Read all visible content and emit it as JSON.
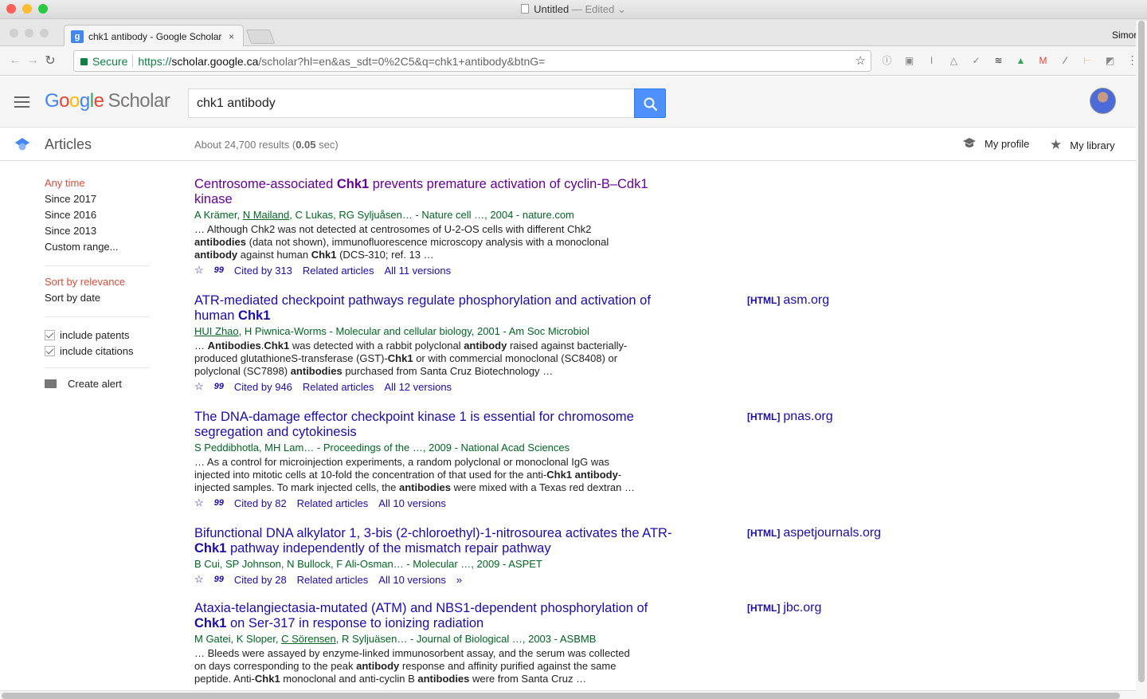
{
  "window": {
    "title": "Untitled",
    "title_suffix": "— Edited ⌄"
  },
  "browser": {
    "tab_title": "chk1 antibody - Google Scholar",
    "tab_close": "×",
    "profile_name": "Simon",
    "secure_label": "Secure",
    "url_scheme": "https://",
    "url_host": "scholar.google.ca",
    "url_path": "/scholar?hl=en&as_sdt=0%2C5&q=chk1+antibody&btnG=",
    "extensions": [
      "info-icon",
      "evernote-icon",
      "instapaper-icon",
      "drive-gray-icon",
      "checkmark-icon",
      "buffer-icon",
      "google-drive-icon",
      "gmail-icon",
      "eyedropper-icon",
      "signpost-icon",
      "extension-icon"
    ]
  },
  "header": {
    "logo_google": [
      "G",
      "o",
      "o",
      "g",
      "l",
      "e"
    ],
    "logo_colors": [
      "#4285f4",
      "#ea4335",
      "#fbbc05",
      "#4285f4",
      "#34a853",
      "#ea4335"
    ],
    "logo_scholar": "Scholar",
    "search_value": "chk1 antibody"
  },
  "subbar": {
    "section": "Articles",
    "results_prefix": "About 24,700 results (",
    "results_time": "0.05",
    "results_suffix": " sec)",
    "my_profile": "My profile",
    "my_library": "My library"
  },
  "sidebar": {
    "time_filters": [
      {
        "label": "Any time",
        "active": true
      },
      {
        "label": "Since 2017",
        "active": false
      },
      {
        "label": "Since 2016",
        "active": false
      },
      {
        "label": "Since 2013",
        "active": false
      },
      {
        "label": "Custom range...",
        "active": false
      }
    ],
    "sort": [
      {
        "label": "Sort by relevance",
        "active": true
      },
      {
        "label": "Sort by date",
        "active": false
      }
    ],
    "include_patents": "include patents",
    "include_citations": "include citations",
    "create_alert": "Create alert"
  },
  "results": [
    {
      "title_html": "Centrosome-associated <b>Chk1</b> prevents premature activation of cyclin-B–Cdk1 kinase",
      "visited": true,
      "meta_html": "A Krämer, <u>N Mailand</u>, C Lukas, RG Syljuåsen… - Nature cell …, 2004 - nature.com",
      "snippet_html": "… Although Chk2 was not detected at centrosomes of U-2-OS cells with different Chk2 <b>antibodies</b> (data not shown), immunofluorescence microscopy analysis with a monoclonal <b>antibody</b> against human <b>Chk1</b> (DCS-310; ref. 13 …",
      "cited_by": "Cited by 313",
      "related": "Related articles",
      "versions": "All 11 versions",
      "side_tag": "",
      "side_domain": ""
    },
    {
      "title_html": "ATR-mediated checkpoint pathways regulate phosphorylation and activation of human <b>Chk1</b>",
      "visited": false,
      "meta_html": "<u>HUI Zhao</u>, H Piwnica-Worms - Molecular and cellular biology, 2001 - Am Soc Microbiol",
      "snippet_html": "… <b>Antibodies</b>.<b>Chk1</b> was detected with a rabbit polyclonal <b>antibody</b> raised against bacterially-produced glutathioneS-transferase (GST)-<b>Chk1</b> or with commercial monoclonal (SC8408) or polyclonal (SC7898) <b>antibodies</b> purchased from Santa Cruz Biotechnology …",
      "cited_by": "Cited by 946",
      "related": "Related articles",
      "versions": "All 12 versions",
      "side_tag": "[HTML]",
      "side_domain": "asm.org"
    },
    {
      "title_html": "The DNA-damage effector checkpoint kinase 1 is essential for chromosome segregation and cytokinesis",
      "visited": false,
      "meta_html": "S Peddibhotla, MH Lam… - Proceedings of the …, 2009 - National Acad Sciences",
      "snippet_html": "… As a control for microinjection experiments, a random polyclonal or monoclonal IgG was injected into mitotic cells at 10-fold the concentration of that used for the anti-<b>Chk1 antibody</b>-injected samples. To mark injected cells, the <b>antibodies</b> were mixed with a Texas red dextran …",
      "cited_by": "Cited by 82",
      "related": "Related articles",
      "versions": "All 10 versions",
      "side_tag": "[HTML]",
      "side_domain": "pnas.org"
    },
    {
      "title_html": "Bifunctional DNA alkylator 1, 3-bis (2-chloroethyl)-1-nitrosourea activates the ATR-<b>Chk1</b> pathway independently of the mismatch repair pathway",
      "visited": false,
      "meta_html": "B Cui, SP Johnson, N Bullock, F Ali-Osman… - Molecular …, 2009 - ASPET",
      "snippet_html": "",
      "cited_by": "Cited by 28",
      "related": "Related articles",
      "versions": "All 10 versions",
      "more": "»",
      "side_tag": "[HTML]",
      "side_domain": "aspetjournals.org"
    },
    {
      "title_html": "Ataxia-telangiectasia-mutated (ATM) and NBS1-dependent phosphorylation of <b>Chk1</b> on Ser-317 in response to ionizing radiation",
      "visited": false,
      "meta_html": "M Gatei, K Sloper, <u>C Sörensen</u>, R Syljuäsen… - Journal of Biological …, 2003 - ASBMB",
      "snippet_html": "… Bleeds were assayed by enzyme-linked immunosorbent assay, and the serum was collected on days corresponding to the peak <b>antibody</b> response and affinity purified against the same peptide. Anti-<b>Chk1</b> monoclonal and anti-cyclin B <b>antibodies</b> were from Santa Cruz …",
      "cited_by": "",
      "related": "",
      "versions": "",
      "side_tag": "[HTML]",
      "side_domain": "jbc.org"
    }
  ],
  "icons": {
    "save": "☆",
    "cite": "99"
  }
}
